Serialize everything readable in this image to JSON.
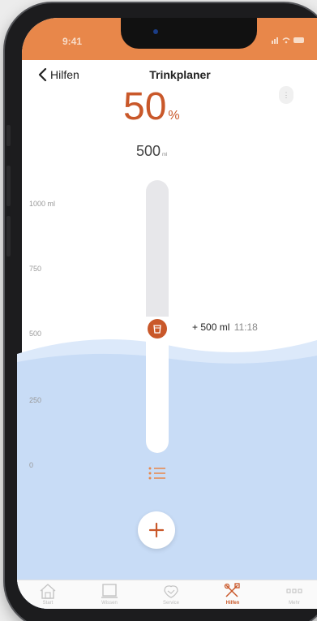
{
  "status_bar": {
    "time": "9:41",
    "icons": "signal wifi battery"
  },
  "nav": {
    "back_label": "Hilfen",
    "title": "Trinkplaner"
  },
  "progress": {
    "percent_value": "50",
    "percent_unit": "%",
    "amount_value": "500",
    "amount_unit": "ml",
    "fill_fraction": 0.5
  },
  "axis_labels": [
    "1000 ml",
    "750",
    "500",
    "250",
    "0"
  ],
  "entry": {
    "amount": "+ 500 ml",
    "time": "11:18"
  },
  "tabs": [
    {
      "label": "Start",
      "icon": "house-icon",
      "active": false
    },
    {
      "label": "Wissen",
      "icon": "book-icon",
      "active": false
    },
    {
      "label": "Service",
      "icon": "handshake-icon",
      "active": false
    },
    {
      "label": "Hilfen",
      "icon": "tools-icon",
      "active": true
    },
    {
      "label": "Mehr",
      "icon": "more-icon",
      "active": false
    }
  ],
  "colors": {
    "accent": "#c9582a",
    "status_bar": "#e8874a",
    "water": "#c8dcf6",
    "water_top": "#dce9fa"
  }
}
